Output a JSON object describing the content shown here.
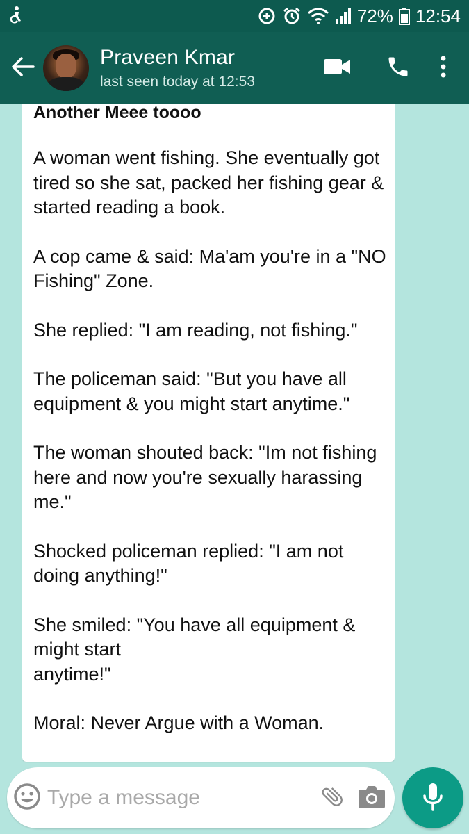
{
  "status_bar": {
    "battery": "72%",
    "time": "12:54"
  },
  "header": {
    "contact_name": "Praveen Kmar",
    "last_seen": "last seen today at 12:53"
  },
  "message": {
    "title": "Another Meee toooo",
    "paragraphs": [
      "A woman went fishing. She eventually got tired so she sat, packed her fishing gear & started reading a book.",
      "A cop came & said: Ma'am you're in a \"NO Fishing\" Zone.",
      "She replied: \"I am reading, not fishing.\"",
      "The policeman said: \"But you have all equipment & you might start anytime.\"",
      "The woman shouted back: \"Im not fishing here and now you're sexually harassing me.\"",
      "Shocked policeman replied: \"I am not doing anything!\"",
      "She smiled: \"You have all equipment & might start\nanytime!\"",
      "Moral: Never Argue with a Woman."
    ]
  },
  "composer": {
    "placeholder": "Type a message"
  },
  "icons": {
    "status_left": "accessibility-icon",
    "status_right": [
      "data-saver-icon",
      "alarm-icon",
      "wifi-icon",
      "signal-icon",
      "battery-icon"
    ],
    "header": [
      "back-arrow-icon",
      "video-call-icon",
      "phone-icon",
      "more-vert-icon"
    ],
    "composer": [
      "emoji-icon",
      "attachment-icon",
      "camera-icon",
      "mic-icon"
    ]
  },
  "colors": {
    "status_bar": "#0d5a4f",
    "app_bar": "#105e53",
    "chat_background": "#b4e5de",
    "mic_button": "#0c9b86"
  }
}
